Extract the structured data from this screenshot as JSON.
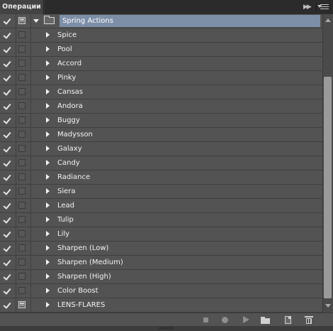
{
  "panel": {
    "tab_label": "Операции"
  },
  "action_set": {
    "name": "Spring Actions",
    "enabled": true,
    "expanded": true
  },
  "actions": [
    {
      "name": "Spice",
      "enabled": true,
      "dialog": false
    },
    {
      "name": "Pool",
      "enabled": true,
      "dialog": false
    },
    {
      "name": "Accord",
      "enabled": true,
      "dialog": false
    },
    {
      "name": "Pinky",
      "enabled": true,
      "dialog": false
    },
    {
      "name": "Cansas",
      "enabled": true,
      "dialog": false
    },
    {
      "name": "Andora",
      "enabled": true,
      "dialog": false
    },
    {
      "name": "Buggy",
      "enabled": true,
      "dialog": false
    },
    {
      "name": "Madysson",
      "enabled": true,
      "dialog": false
    },
    {
      "name": "Galaxy",
      "enabled": true,
      "dialog": false
    },
    {
      "name": "Candy",
      "enabled": true,
      "dialog": false
    },
    {
      "name": "Radiance",
      "enabled": true,
      "dialog": false
    },
    {
      "name": "Siera",
      "enabled": true,
      "dialog": false
    },
    {
      "name": "Lead",
      "enabled": true,
      "dialog": false
    },
    {
      "name": "Tulip",
      "enabled": true,
      "dialog": false
    },
    {
      "name": "Lily",
      "enabled": true,
      "dialog": false
    },
    {
      "name": "Sharpen (Low)",
      "enabled": true,
      "dialog": false
    },
    {
      "name": "Sharpen (Medium)",
      "enabled": true,
      "dialog": false
    },
    {
      "name": "Sharpen (High)",
      "enabled": true,
      "dialog": false
    },
    {
      "name": "Color Boost",
      "enabled": true,
      "dialog": false
    },
    {
      "name": "LENS-FLARES",
      "enabled": true,
      "dialog": true
    }
  ],
  "toolbar": {
    "icons": [
      "stop-icon",
      "record-icon",
      "play-icon",
      "new-set-folder-icon",
      "new-action-icon",
      "trash-icon"
    ]
  },
  "colors": {
    "panel_bg": "#535353",
    "selected_set_bg": "#7d8ea7",
    "tab_bar_bg": "#2b2b2b"
  }
}
